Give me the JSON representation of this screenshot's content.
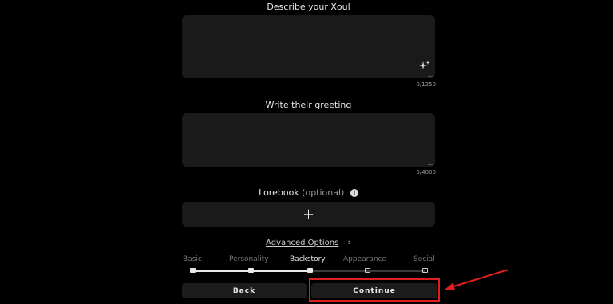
{
  "form": {
    "describe": {
      "label": "Describe your Xoul",
      "counter": "0/1250"
    },
    "greeting": {
      "label": "Write their greeting",
      "counter": "0/4000"
    },
    "lorebook": {
      "label": "Lorebook",
      "optional": "(optional)"
    },
    "advanced_options": "Advanced Options"
  },
  "stepper": {
    "steps": [
      {
        "label": "Basic"
      },
      {
        "label": "Personality"
      },
      {
        "label": "Backstory",
        "active": true
      },
      {
        "label": "Appearance"
      },
      {
        "label": "Social"
      }
    ]
  },
  "buttons": {
    "back": "Back",
    "continue": "Continue"
  },
  "colors": {
    "highlight": "#e02020",
    "background": "#000000",
    "field": "#1a1a1a"
  }
}
